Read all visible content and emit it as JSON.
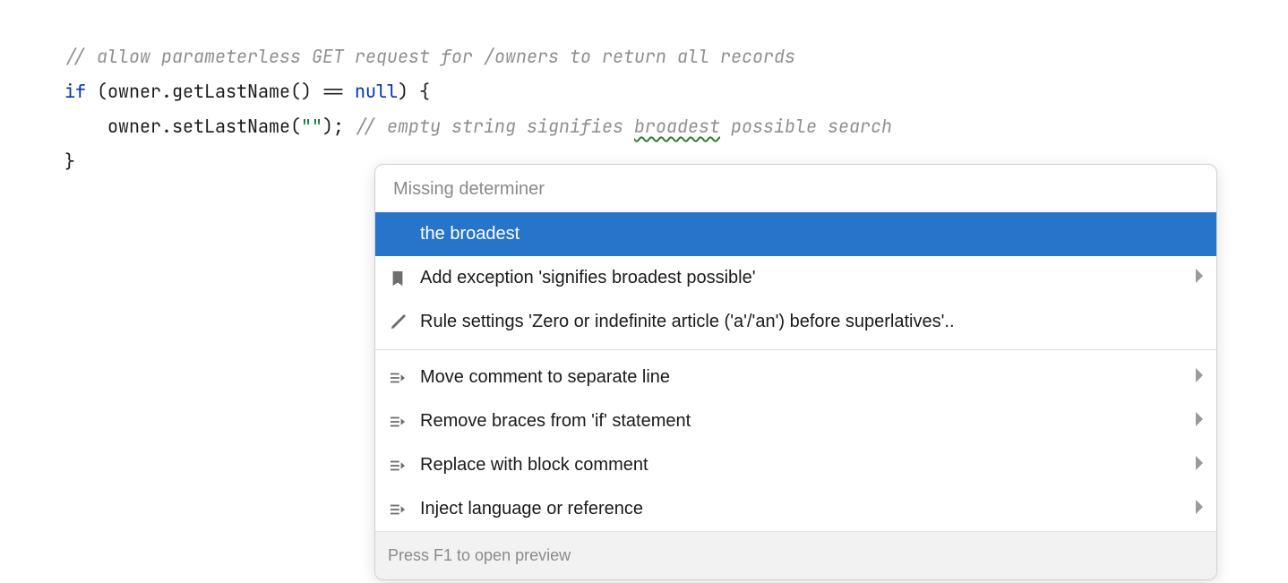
{
  "code": {
    "line1_comment": "// allow parameterless GET request for /owners to return all records",
    "line2_if": "if",
    "line2_cond_open": " (owner.getLastName() == ",
    "line2_null": "null",
    "line2_cond_close": ") {",
    "line3_indent": "    owner.setLastName(",
    "line3_str": "\"\"",
    "line3_after": "); ",
    "line3_comment_pre": "// empty string signifies ",
    "line3_comment_word": "broadest",
    "line3_comment_post": " possible search",
    "line4_close": "}"
  },
  "popup": {
    "title": "Missing determiner",
    "items1": [
      {
        "label": "the broadest",
        "selected": true,
        "icon": "none",
        "chev": false
      },
      {
        "label": "Add exception 'signifies broadest possible'",
        "selected": false,
        "icon": "bookmark",
        "chev": true
      },
      {
        "label": "Rule settings 'Zero or indefinite article ('a'/'an') before superlatives'..",
        "selected": false,
        "icon": "pencil",
        "chev": false
      }
    ],
    "items2": [
      {
        "label": "Move comment to separate line",
        "selected": false,
        "icon": "intent",
        "chev": true
      },
      {
        "label": "Remove braces from 'if' statement",
        "selected": false,
        "icon": "intent",
        "chev": true
      },
      {
        "label": "Replace with block comment",
        "selected": false,
        "icon": "intent",
        "chev": true
      },
      {
        "label": "Inject language or reference",
        "selected": false,
        "icon": "intent",
        "chev": true
      }
    ],
    "footer": "Press F1 to open preview"
  }
}
